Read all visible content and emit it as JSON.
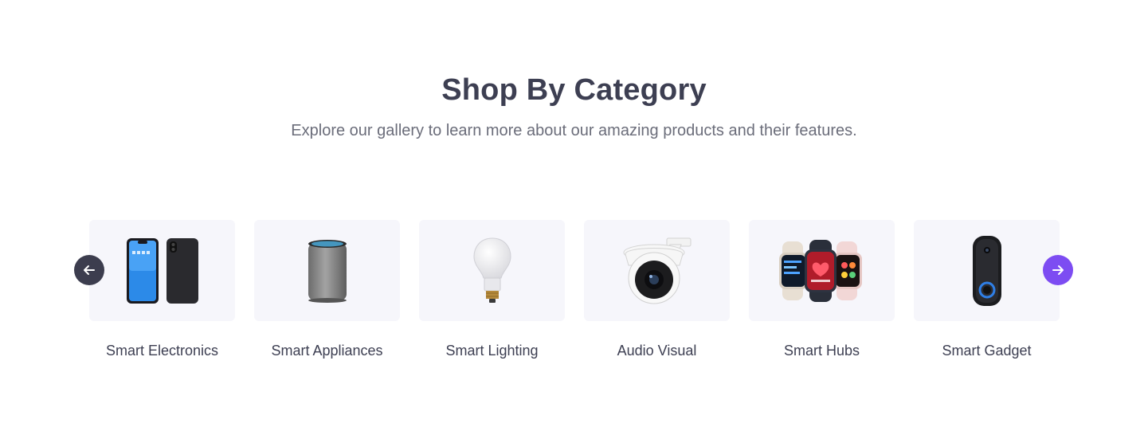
{
  "section": {
    "title": "Shop By Category",
    "subtitle": "Explore our gallery to learn more about our amazing products and their features."
  },
  "carousel": {
    "prev_icon": "arrow-left-icon",
    "next_icon": "arrow-right-icon",
    "prev_color": "#3c3d4e",
    "next_color": "#7d4cf2",
    "categories": [
      {
        "label": "Smart Electronics",
        "icon": "smartphone-image"
      },
      {
        "label": "Smart Appliances",
        "icon": "smart-speaker-image"
      },
      {
        "label": "Smart Lighting",
        "icon": "light-bulb-image"
      },
      {
        "label": "Audio Visual",
        "icon": "security-camera-image"
      },
      {
        "label": "Smart Hubs",
        "icon": "smartwatch-image"
      },
      {
        "label": "Smart Gadget",
        "icon": "video-doorbell-image"
      }
    ]
  }
}
